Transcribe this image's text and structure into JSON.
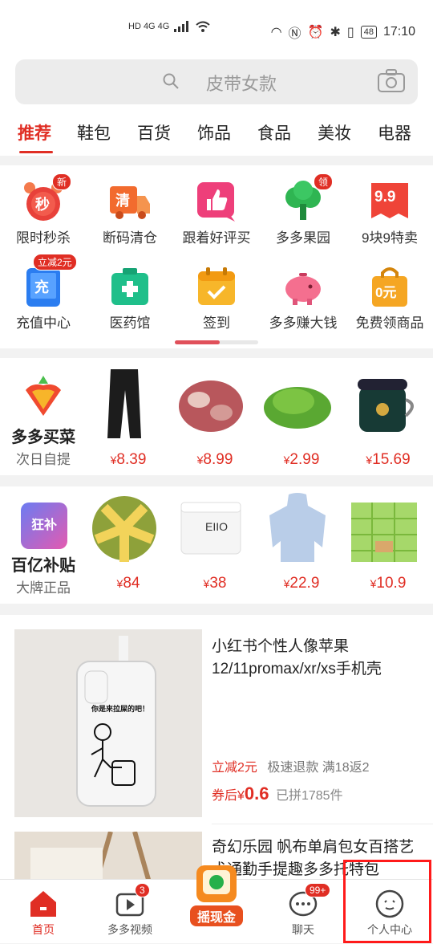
{
  "status_bar": {
    "left_indicators": "HD 4G 4G",
    "battery": "48",
    "time": "17:10"
  },
  "search": {
    "placeholder": "皮带女款"
  },
  "category_tabs": [
    "推荐",
    "鞋包",
    "百货",
    "饰品",
    "食品",
    "美妆",
    "电器"
  ],
  "quick_icons": [
    {
      "label": "限时秒杀",
      "icon": "alarm-clock-icon",
      "glyph": "秒",
      "badge": "新"
    },
    {
      "label": "断码清仓",
      "icon": "truck-icon",
      "glyph": "清"
    },
    {
      "label": "跟着好评买",
      "icon": "thumbs-up-icon"
    },
    {
      "label": "多多果园",
      "icon": "tree-icon",
      "badge": "领"
    },
    {
      "label": "9块9特卖",
      "icon": "tag-icon",
      "glyph": "9.9"
    },
    {
      "label": "充值中心",
      "icon": "phone-icon",
      "glyph": "充",
      "badge": "立减2元"
    },
    {
      "label": "医药馆",
      "icon": "medicine-box-icon"
    },
    {
      "label": "签到",
      "icon": "calendar-icon"
    },
    {
      "label": "多多赚大钱",
      "icon": "piggy-bank-icon"
    },
    {
      "label": "免费领商品",
      "icon": "shopping-bag-icon",
      "glyph": "0元"
    }
  ],
  "grocery_row": {
    "title": "多多买菜",
    "subtitle": "次日自提",
    "items": [
      {
        "name": "pants",
        "price": "8.39"
      },
      {
        "name": "pork-bones",
        "price": "8.99"
      },
      {
        "name": "greens",
        "price": "2.99"
      },
      {
        "name": "lunch-box",
        "price": "15.69"
      }
    ]
  },
  "subsidy_row": {
    "title": "百亿补贴",
    "subtitle": "大牌正品",
    "logo_text": "狂补",
    "items": [
      {
        "name": "durian",
        "price": "84"
      },
      {
        "name": "cream-jar",
        "price": "38",
        "brand": "EIIO"
      },
      {
        "name": "sun-jacket",
        "price": "22.9"
      },
      {
        "name": "tissue-pack",
        "price": "10.9"
      }
    ]
  },
  "currency": "¥",
  "products": [
    {
      "title": "小红书个性人像苹果12/11promax/xr/xs手机壳",
      "case_text": "你是來拉屎的吧！",
      "discount": "立减2元",
      "tags": "极速退款  满18返2",
      "price_prefix": "券后",
      "price": "0.6",
      "sold": "已拼1785件"
    },
    {
      "title": "奇幻乐园 帆布单肩包女百搭艺术通勤手提趣多多托特包"
    }
  ],
  "bottom_tabs": [
    {
      "label": "首页",
      "icon": "home-icon",
      "active": true
    },
    {
      "label": "多多视频",
      "icon": "video-icon",
      "badge": "3"
    },
    {
      "label": "摇现金",
      "icon": "shake-cash-icon"
    },
    {
      "label": "聊天",
      "icon": "chat-icon",
      "badge": "99+"
    },
    {
      "label": "个人中心",
      "icon": "profile-icon"
    }
  ]
}
